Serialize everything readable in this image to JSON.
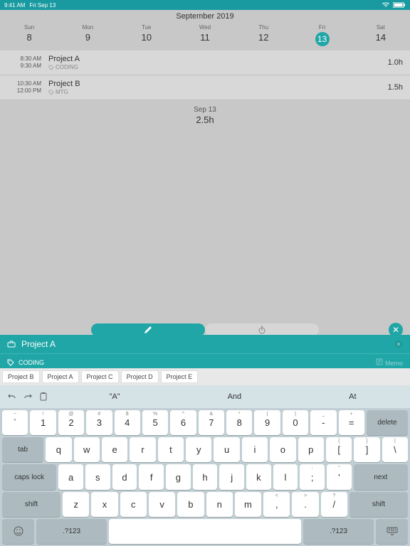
{
  "status": {
    "time": "9:41 AM",
    "date": "Fri Sep 13"
  },
  "header": {
    "month": "September 2019"
  },
  "days": [
    {
      "name": "Sun",
      "num": "8"
    },
    {
      "name": "Mon",
      "num": "9"
    },
    {
      "name": "Tue",
      "num": "10"
    },
    {
      "name": "Wed",
      "num": "11"
    },
    {
      "name": "Thu",
      "num": "12"
    },
    {
      "name": "Fri",
      "num": "13",
      "sel": true
    },
    {
      "name": "Sat",
      "num": "14"
    }
  ],
  "entries": [
    {
      "start": "8:30 AM",
      "end": "9:30 AM",
      "title": "Project A",
      "tag": "CODING",
      "hrs": "1.0h"
    },
    {
      "start": "10:30 AM",
      "end": "12:00 PM",
      "title": "Project B",
      "tag": "MTG",
      "hrs": "1.5h"
    }
  ],
  "summary": {
    "date": "Sep 13",
    "total": "2.5h"
  },
  "input": {
    "value": "Project A",
    "tag": "CODING",
    "memo": "Memo"
  },
  "suggestions": [
    "Project B",
    "Project A",
    "Project C",
    "Project D",
    "Project E"
  ],
  "preds": [
    "\"A\"",
    "And",
    "At"
  ],
  "keys": {
    "r1": [
      [
        "~",
        "`"
      ],
      [
        "!",
        "1"
      ],
      [
        "@",
        "2"
      ],
      [
        "#",
        "3"
      ],
      [
        "$",
        "4"
      ],
      [
        "%",
        "5"
      ],
      [
        "^",
        "6"
      ],
      [
        "&",
        "7"
      ],
      [
        "*",
        "8"
      ],
      [
        "(",
        "9"
      ],
      [
        ")",
        "0"
      ],
      [
        "_",
        "-"
      ],
      [
        "+",
        "="
      ]
    ],
    "r2": [
      "q",
      "w",
      "e",
      "r",
      "t",
      "y",
      "u",
      "i",
      "o",
      "p"
    ],
    "r2b": [
      [
        "{",
        "["
      ],
      [
        "}",
        "]"
      ],
      [
        "|",
        "\\"
      ]
    ],
    "r3": [
      "a",
      "s",
      "d",
      "f",
      "g",
      "h",
      "j",
      "k",
      "l"
    ],
    "r3b": [
      [
        ":",
        ";"
      ],
      [
        "\"",
        "'"
      ]
    ],
    "r4": [
      "z",
      "x",
      "c",
      "v",
      "b",
      "n",
      "m"
    ],
    "r4b": [
      [
        "<",
        ","
      ],
      [
        ">",
        "."
      ],
      [
        "?",
        "/"
      ]
    ],
    "delete": "delete",
    "tab": "tab",
    "caps": "caps lock",
    "next": "next",
    "shift": "shift",
    "numkey": ".?123"
  }
}
